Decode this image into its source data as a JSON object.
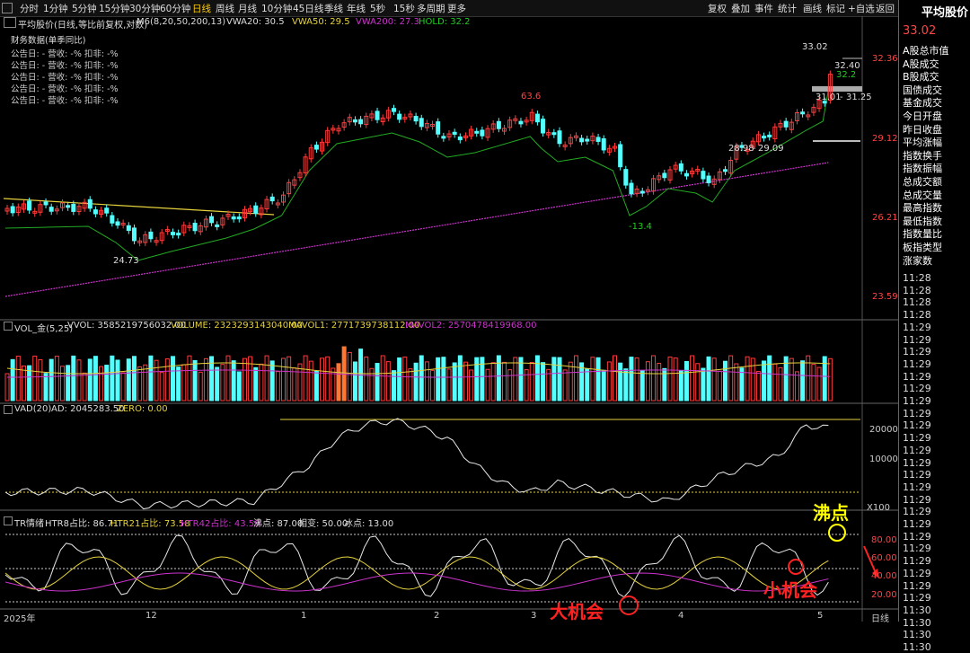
{
  "toolbar": {
    "periods": [
      "分时",
      "1分钟",
      "5分钟",
      "15分钟",
      "30分钟",
      "60分钟",
      "日线",
      "周线",
      "月线",
      "10分钟",
      "45日线",
      "季线",
      "年线",
      "5秒",
      "15秒",
      "多周期",
      "更多"
    ],
    "active": "日线",
    "right": [
      "复权",
      "叠加",
      "事件",
      "统计",
      "画线",
      "标记",
      "+自选",
      "返回"
    ]
  },
  "right_panel": {
    "title": "平均股价",
    "price": "33.02",
    "items": [
      "A股总市值",
      "A股成交",
      "B股成交",
      "国债成交",
      "基金成交",
      "今日开盘",
      "昨日收盘",
      "平均涨幅",
      "指数换手",
      "指数振幅",
      "总成交额",
      "总成交量",
      "最高指数",
      "最低指数",
      "指数量比",
      "板指类型",
      "涨家数"
    ],
    "times": [
      "11:28",
      "11:28",
      "11:28",
      "11:28",
      "11:29",
      "11:29",
      "11:29",
      "11:29",
      "11:29",
      "11:29",
      "11:29",
      "11:29",
      "11:29",
      "11:29",
      "11:29",
      "11:29",
      "11:29",
      "11:29",
      "11:29",
      "11:29",
      "11:29",
      "11:29",
      "11:29",
      "11:29",
      "11:29",
      "11:29",
      "11:29",
      "11:30",
      "11:30",
      "11:30",
      "11:30"
    ]
  },
  "main_pane": {
    "title": "平均股价(日线,等比前复权,对数)",
    "indicator": "M6(8,20,50,200,13)",
    "vwa20": "VWA20: 30.5",
    "vwa50": "VWA50: 29.5",
    "vwa200": "VWA200: 27.3",
    "hold": "HOLD: 32.2",
    "financial_title": "财务数据(单季同比)",
    "financial_rows": [
      "公告日: -   营收: -%   扣非: -%",
      "公告日: -   营收: -%   扣非: -%",
      "公告日: -   营收: -%   扣非: -%",
      "公告日: -   营收: -%   扣非: -%",
      "公告日: -   营收: -%   扣非: -%"
    ],
    "y_ticks": [
      "32.36",
      "29.12",
      "26.21",
      "23.59"
    ],
    "annotations": {
      "low": "24.73",
      "peak": "63.6",
      "dip": "-13.4",
      "a1": "28.98",
      "a2": "29.09",
      "a3": "31.01",
      "a4": "31.25",
      "a5": "32.40",
      "a6": "32.2",
      "high": "33.02"
    }
  },
  "vol_pane": {
    "title": "VOL_金(5,25)",
    "vvol": "VVOL: 3585219756032.00",
    "volume": "VOLUME: 2323293143040.00",
    "mavol1": "MAVOL1: 2771739738112.00",
    "mavol2": "MAVOL2: 2570478419968.00"
  },
  "vad_pane": {
    "title": "VAD(20)",
    "ad": "AD: 2045283.50",
    "zero": "ZERO: 0.00",
    "y_ticks": [
      "20000",
      "10000"
    ]
  },
  "tr_pane": {
    "title": "TR情绪",
    "htr8": "HTR8占比: 86.71",
    "htr21": "HTR21占比: 73.58",
    "htr42": "HTR42占比: 43.59",
    "boil": "沸点: 87.00",
    "mid": "相变: 50.00",
    "ice": "冰点: 13.00",
    "scale": "X100",
    "y_ticks": [
      "80.00",
      "60.00",
      "40.00",
      "20.00"
    ],
    "boil_label": "沸点",
    "big_chance": "大机会",
    "small_chance": "小机会"
  },
  "x_axis": {
    "labels": [
      "2025年",
      "12",
      "1",
      "2",
      "3",
      "4",
      "5"
    ],
    "period": "日线"
  },
  "colors": {
    "up": "#ff3b3b",
    "down": "#54ffff",
    "hold_line": "#22aa22",
    "vwa200": "#cc33cc",
    "yellow": "#e6d23c",
    "white": "#e8e8e8",
    "orange": "#ff7733"
  }
}
